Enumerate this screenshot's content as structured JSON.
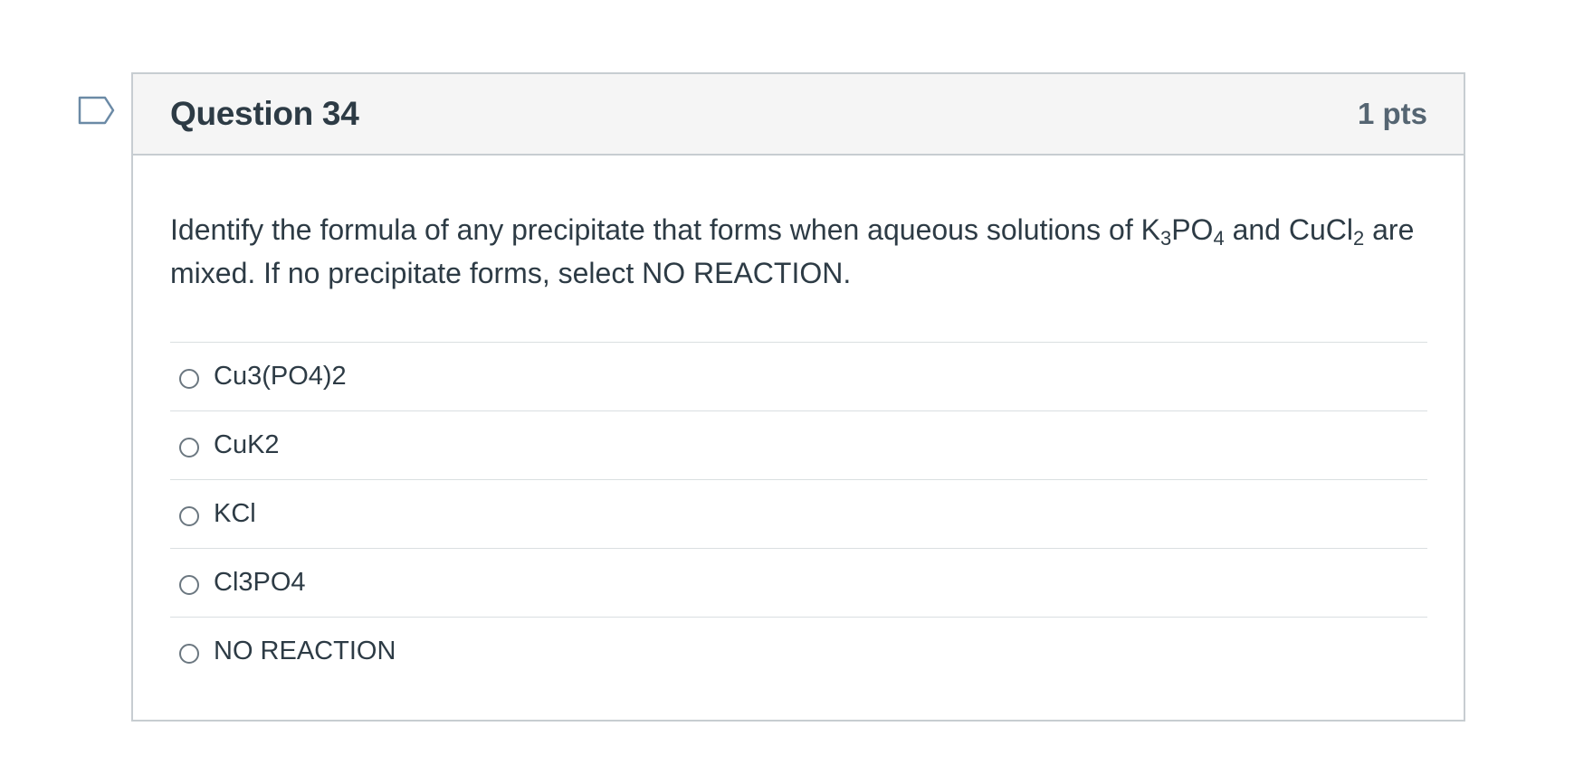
{
  "question": {
    "title": "Question 34",
    "points": "1 pts",
    "text_parts": {
      "p1": "Identify the formula of any precipitate that forms when aqueous solutions of K",
      "sub1": "3",
      "p2": "PO",
      "sub2": "4",
      "p3": " and CuCl",
      "sub3": "2",
      "p4": " are mixed. If no precipitate forms, select NO REACTION."
    },
    "answers": [
      {
        "label": "Cu3(PO4)2",
        "selected": false
      },
      {
        "label": "CuK2",
        "selected": false
      },
      {
        "label": "KCl",
        "selected": false
      },
      {
        "label": "Cl3PO4",
        "selected": false
      },
      {
        "label": "NO REACTION",
        "selected": false
      }
    ]
  },
  "icons": {
    "flag": "flag-bookmark-icon"
  },
  "colors": {
    "header_bg": "#f5f5f5",
    "border": "#c7cdd1",
    "text": "#2d3b45",
    "flag": "#6b8aa6"
  }
}
